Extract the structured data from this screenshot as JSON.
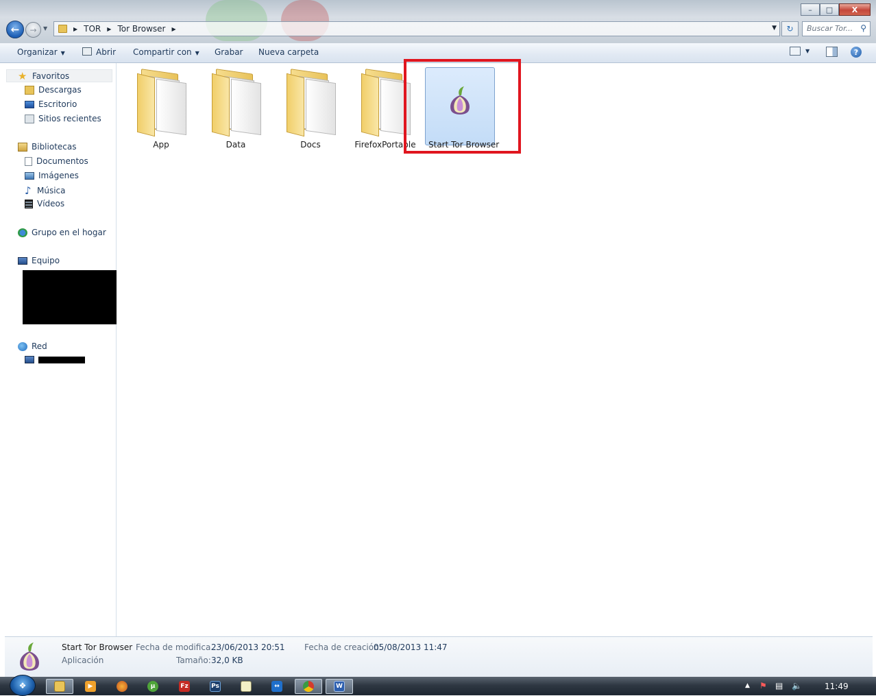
{
  "window": {
    "minimize_glyph": "–",
    "maximize_glyph": "□",
    "close_glyph": "X"
  },
  "address": {
    "breadcrumbs": [
      "TOR",
      "Tor Browser"
    ],
    "search_placeholder": "Buscar Tor..."
  },
  "toolbar": {
    "organize": "Organizar",
    "open": "Abrir",
    "share": "Compartir con",
    "burn": "Grabar",
    "new_folder": "Nueva carpeta"
  },
  "sidebar": {
    "favorites": "Favoritos",
    "downloads": "Descargas",
    "desktop": "Escritorio",
    "recent": "Sitios recientes",
    "libraries": "Bibliotecas",
    "documents": "Documentos",
    "images": "Imágenes",
    "music": "Música",
    "videos": "Vídeos",
    "homegroup": "Grupo en el hogar",
    "computer": "Equipo",
    "network": "Red"
  },
  "files": [
    {
      "name": "App",
      "type": "folder"
    },
    {
      "name": "Data",
      "type": "folder"
    },
    {
      "name": "Docs",
      "type": "folder"
    },
    {
      "name": "FirefoxPortable",
      "type": "folder"
    },
    {
      "name": "Start Tor Browser",
      "type": "application",
      "selected": true
    }
  ],
  "details": {
    "name": "Start Tor Browser",
    "type": "Aplicación",
    "modified_label": "Fecha de modifica...",
    "modified_value": "23/06/2013 20:51",
    "size_label": "Tamaño:",
    "size_value": "32,0 KB",
    "created_label": "Fecha de creación:",
    "created_value": "05/08/2013 11:47"
  },
  "taskbar": {
    "clock": "11:49",
    "apps": [
      "explorer-icon",
      "media-player-icon",
      "firefox-icon",
      "utorrent-icon",
      "filezilla-icon",
      "photoshop-icon",
      "notepad-icon",
      "teamviewer-icon",
      "chrome-icon",
      "word-icon"
    ]
  },
  "colors": {
    "highlight_border": "#e0161f",
    "selection_fill": "#cfe3fa",
    "link_text": "#1e395b"
  }
}
